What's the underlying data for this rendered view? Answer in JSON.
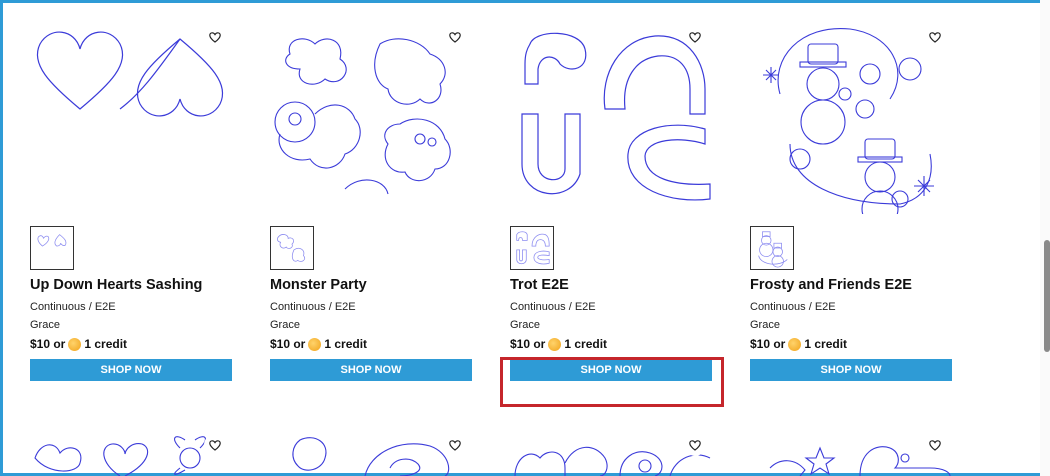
{
  "products": [
    {
      "title": "Up Down Hearts Sashing",
      "category": "Continuous / E2E",
      "designer": "Grace",
      "price_prefix": "$10 or",
      "credit": "1 credit",
      "button": "SHOP NOW"
    },
    {
      "title": "Monster Party",
      "category": "Continuous / E2E",
      "designer": "Grace",
      "price_prefix": "$10 or",
      "credit": "1 credit",
      "button": "SHOP NOW"
    },
    {
      "title": "Trot E2E",
      "category": "Continuous / E2E",
      "designer": "Grace",
      "price_prefix": "$10 or",
      "credit": "1 credit",
      "button": "SHOP NOW"
    },
    {
      "title": "Frosty and Friends E2E",
      "category": "Continuous / E2E",
      "designer": "Grace",
      "price_prefix": "$10 or",
      "credit": "1 credit",
      "button": "SHOP NOW"
    }
  ],
  "icons": {
    "favorite": "heart-outline-icon",
    "coin": "coin-icon"
  },
  "colors": {
    "button": "#2e9bd6",
    "highlight": "#c5262b",
    "art_stroke": "#3b3bd9",
    "coin": "#f0a21a"
  }
}
